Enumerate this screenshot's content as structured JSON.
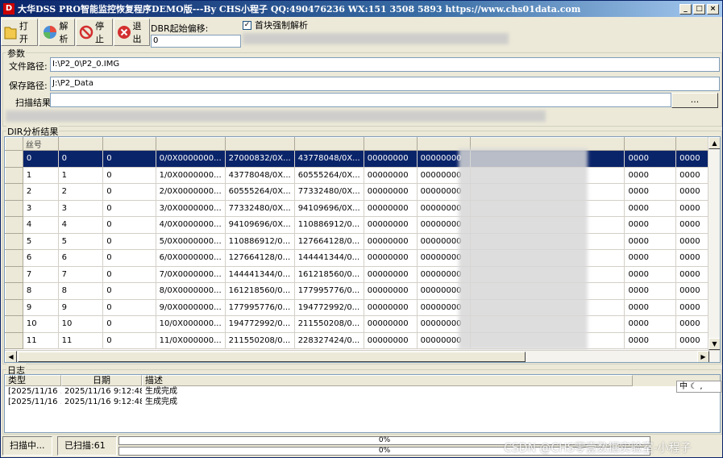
{
  "titlebar": {
    "icon_letter": "D",
    "title": "大华DSS PRO智能监控恢复程序DEMO版---By CHS小程子 QQ:490476236 WX:151 3508 5893  https://www.chs01data.com",
    "min_label": "_",
    "max_label": "□",
    "close_label": "×"
  },
  "toolbar": {
    "open_label": "打开",
    "parse_label": "解析",
    "stop_label": "停止",
    "exit_label": "退出"
  },
  "dbr": {
    "label": "DBR起始偏移:",
    "value": "0"
  },
  "force": {
    "label": "首块强制解析",
    "checked": "✓"
  },
  "params": {
    "group_label": "参数",
    "file_label": "文件路径:",
    "file_value": "I:\\P2_0\\P2_0.IMG",
    "save_label": "保存路径:",
    "save_value": "J:\\P2_Data",
    "scan_label": "扫描结果:",
    "scan_value": "",
    "browse_label": "..."
  },
  "dir": {
    "group_label": "DIR分析结果",
    "header_first": "丝号",
    "rows": [
      [
        "0",
        "0",
        "0",
        "0/0X0000000...",
        "27000832/0X...",
        "43778048/0X...",
        "00000000",
        "00000000",
        "0000",
        "0000"
      ],
      [
        "1",
        "1",
        "0",
        "1/0X0000000...",
        "43778048/0X...",
        "60555264/0X...",
        "00000000",
        "00000000",
        "0000",
        "0000"
      ],
      [
        "2",
        "2",
        "0",
        "2/0X0000000...",
        "60555264/0X...",
        "77332480/0X...",
        "00000000",
        "00000000",
        "0000",
        "0000"
      ],
      [
        "3",
        "3",
        "0",
        "3/0X0000000...",
        "77332480/0X...",
        "94109696/0X...",
        "00000000",
        "00000000",
        "0000",
        "0000"
      ],
      [
        "4",
        "4",
        "0",
        "4/0X0000000...",
        "94109696/0X...",
        "110886912/0...",
        "00000000",
        "00000000",
        "0000",
        "0000"
      ],
      [
        "5",
        "5",
        "0",
        "5/0X0000000...",
        "110886912/0...",
        "127664128/0...",
        "00000000",
        "00000000",
        "0000",
        "0000"
      ],
      [
        "6",
        "6",
        "0",
        "6/0X0000000...",
        "127664128/0...",
        "144441344/0...",
        "00000000",
        "00000000",
        "0000",
        "0000"
      ],
      [
        "7",
        "7",
        "0",
        "7/0X0000000...",
        "144441344/0...",
        "161218560/0...",
        "00000000",
        "00000000",
        "0000",
        "0000"
      ],
      [
        "8",
        "8",
        "0",
        "8/0X0000000...",
        "161218560/0...",
        "177995776/0...",
        "00000000",
        "00000000",
        "0000",
        "0000"
      ],
      [
        "9",
        "9",
        "0",
        "9/0X0000000...",
        "177995776/0...",
        "194772992/0...",
        "00000000",
        "00000000",
        "0000",
        "0000"
      ],
      [
        "10",
        "10",
        "0",
        "10/0X000000...",
        "194772992/0...",
        "211550208/0...",
        "00000000",
        "00000000",
        "0000",
        "0000"
      ],
      [
        "11",
        "11",
        "0",
        "11/0X000000...",
        "211550208/0...",
        "228327424/0...",
        "00000000",
        "00000000",
        "0000",
        "0000"
      ]
    ]
  },
  "log": {
    "group_label": "日志",
    "headers": [
      "类型",
      "日期",
      "描述"
    ],
    "rows": [
      [
        "[2025/11/16 ...",
        "2025/11/16 9:12:48",
        "生成完成"
      ],
      [
        "[2025/11/16 ...",
        "2025/11/16 9:12:48",
        "生成完成"
      ]
    ]
  },
  "ime": {
    "label": "中 ☾ ,"
  },
  "status": {
    "state": "扫描中...",
    "scanned": "已扫描:61",
    "progress1": "0%",
    "progress2": "0%",
    "progress1_value": 0,
    "progress2_value": 0
  },
  "watermark": "CSDN @CHS零壹数据实验室-小程子"
}
